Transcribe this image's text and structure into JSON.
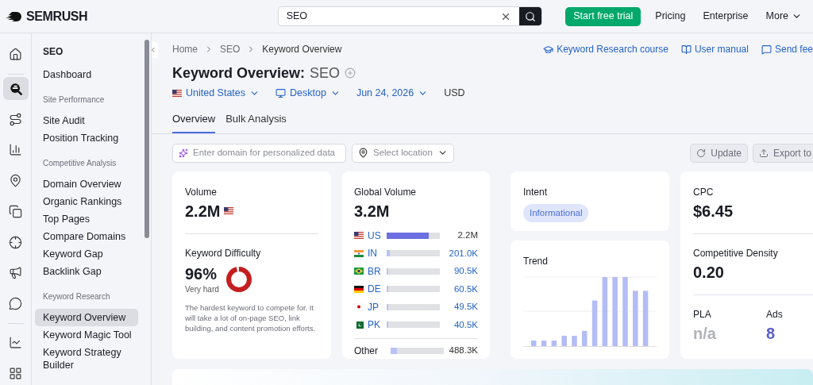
{
  "header": {
    "logo": "SEMRUSH",
    "search": {
      "value": "SEO"
    },
    "trial_button": "Start free trial",
    "nav": [
      "Pricing",
      "Enterprise",
      "More"
    ]
  },
  "rail": [
    {
      "selected": false
    },
    {
      "selected": true
    },
    {
      "selected": false
    },
    {
      "selected": false
    },
    {
      "selected": false
    },
    {
      "selected": false
    },
    {
      "selected": false
    },
    {
      "selected": false
    },
    {
      "selected": false
    },
    {
      "selected": false
    },
    {
      "selected": false
    }
  ],
  "sidebar": {
    "title": "SEO",
    "groups": [
      {
        "items": [
          {
            "label": "Dashboard",
            "selected": false
          }
        ]
      },
      {
        "heading": "Site Performance",
        "items": [
          {
            "label": "Site Audit",
            "selected": false
          },
          {
            "label": "Position Tracking",
            "selected": false
          }
        ]
      },
      {
        "heading": "Competitive Analysis",
        "items": [
          {
            "label": "Domain Overview",
            "selected": false
          },
          {
            "label": "Organic Rankings",
            "selected": false
          },
          {
            "label": "Top Pages",
            "selected": false
          },
          {
            "label": "Compare Domains",
            "selected": false
          },
          {
            "label": "Keyword Gap",
            "selected": false
          },
          {
            "label": "Backlink Gap",
            "selected": false
          }
        ]
      },
      {
        "heading": "Keyword Research",
        "items": [
          {
            "label": "Keyword Overview",
            "selected": true
          },
          {
            "label": "Keyword Magic Tool",
            "selected": false
          },
          {
            "label": "Keyword Strategy Builder",
            "selected": false
          }
        ]
      }
    ]
  },
  "breadcrumb": [
    "Home",
    "SEO",
    "Keyword Overview"
  ],
  "links": [
    "Keyword Research course",
    "User manual",
    "Send fee"
  ],
  "title": "Keyword Overview:",
  "keyword": "SEO",
  "filters": {
    "country": "United States",
    "device": "Desktop",
    "date": "Jun 24, 2026",
    "currency": "USD"
  },
  "tabs": [
    {
      "label": "Overview",
      "selected": true
    },
    {
      "label": "Bulk Analysis",
      "selected": false
    }
  ],
  "domain_field": {
    "placeholder": "Enter domain for personalized data"
  },
  "location_select": {
    "placeholder": "Select location"
  },
  "buttons": [
    "Update",
    "Export to"
  ],
  "volume": {
    "label": "Volume",
    "value": "2.2M"
  },
  "difficulty": {
    "label": "Keyword Difficulty",
    "value": "96%",
    "rating": "Very hard",
    "description": "The hardest keyword to compete for. It will take a lot of on-page SEO, link building, and content promotion efforts."
  },
  "global_volume": {
    "label": "Global Volume",
    "value": "3.2M",
    "countries": [
      {
        "code": "US",
        "level": 0.79,
        "value": "2.2M"
      },
      {
        "code": "IN",
        "level": 0.06,
        "value": "201.0K"
      },
      {
        "code": "BR",
        "level": 0.03,
        "value": "90.5K"
      },
      {
        "code": "DE",
        "level": 0.03,
        "value": "60.5K"
      },
      {
        "code": "JP",
        "level": 0.03,
        "value": "49.5K"
      },
      {
        "code": "PK",
        "level": 0.03,
        "value": "40.5K"
      }
    ],
    "other": {
      "label": "Other",
      "level": 0.12,
      "value": "488.3K"
    }
  },
  "intent": {
    "label": "Intent",
    "tag": "Informational"
  },
  "trend": {
    "label": "Trend"
  },
  "cpc": {
    "label": "CPC",
    "value": "$6.45"
  },
  "density": {
    "label": "Competitive Density",
    "value": "0.20"
  },
  "pla": {
    "label": "PLA",
    "value": "n/a"
  },
  "ads": {
    "label": "Ads",
    "value": "8"
  }
}
